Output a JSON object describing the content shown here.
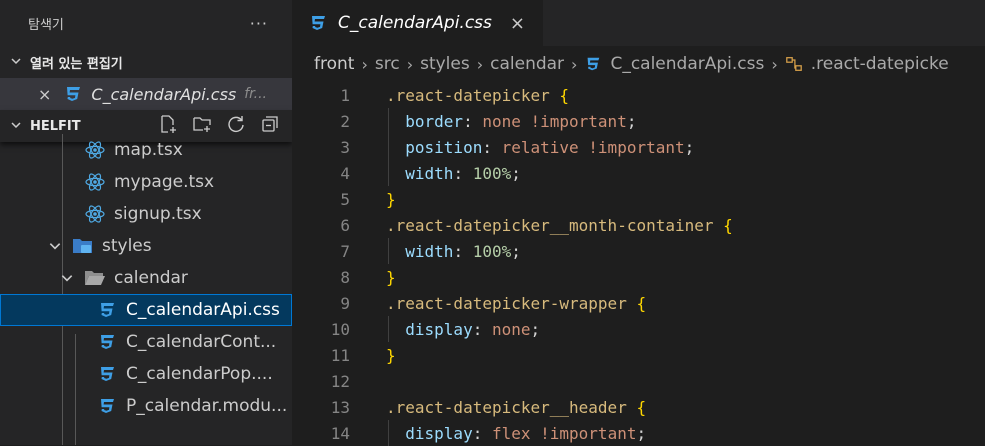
{
  "sidebar": {
    "title": "탐색기",
    "more": "···",
    "open_editors": {
      "label": "열려 있는 편집기",
      "items": [
        {
          "close": "×",
          "name": "C_calendarApi.css",
          "path": "fr..."
        }
      ]
    },
    "project": {
      "label": "HELFIT",
      "tree": [
        {
          "name": "map.tsx",
          "type": "react"
        },
        {
          "name": "mypage.tsx",
          "type": "react"
        },
        {
          "name": "signup.tsx",
          "type": "react"
        },
        {
          "name": "styles",
          "type": "folder-styles"
        },
        {
          "name": "calendar",
          "type": "folder"
        },
        {
          "name": "C_calendarApi.css",
          "type": "css"
        },
        {
          "name": "C_calendarCont...",
          "type": "css"
        },
        {
          "name": "C_calendarPop....",
          "type": "css"
        },
        {
          "name": "P_calendar.modu...",
          "type": "css"
        }
      ]
    }
  },
  "editor": {
    "tab": {
      "label": "C_calendarApi.css",
      "close": "×"
    },
    "breadcrumb": [
      "front",
      "src",
      "styles",
      "calendar",
      "C_calendarApi.css",
      ".react-datepicke"
    ],
    "lines": [
      "1",
      "2",
      "3",
      "4",
      "5",
      "6",
      "7",
      "8",
      "9",
      "10",
      "11",
      "12",
      "13",
      "14"
    ],
    "code": {
      "l1_sel": ".react-datepicker",
      "l2_prop": "border",
      "l2_val": "none !important",
      "l3_prop": "position",
      "l3_val": "relative !important",
      "l4_prop": "width",
      "l4_val": "100%",
      "l6_sel": ".react-datepicker__month-container",
      "l7_prop": "width",
      "l7_val": "100%",
      "l9_sel": ".react-datepicker-wrapper",
      "l10_prop": "display",
      "l10_val": "none",
      "l13_sel": ".react-datepicker__header",
      "l14_prop": "display",
      "l14_val": "flex !important"
    }
  },
  "colors": {
    "css_icon": "#3e9fe6",
    "react_icon": "#4fa9e3",
    "selection": "#04395e"
  }
}
